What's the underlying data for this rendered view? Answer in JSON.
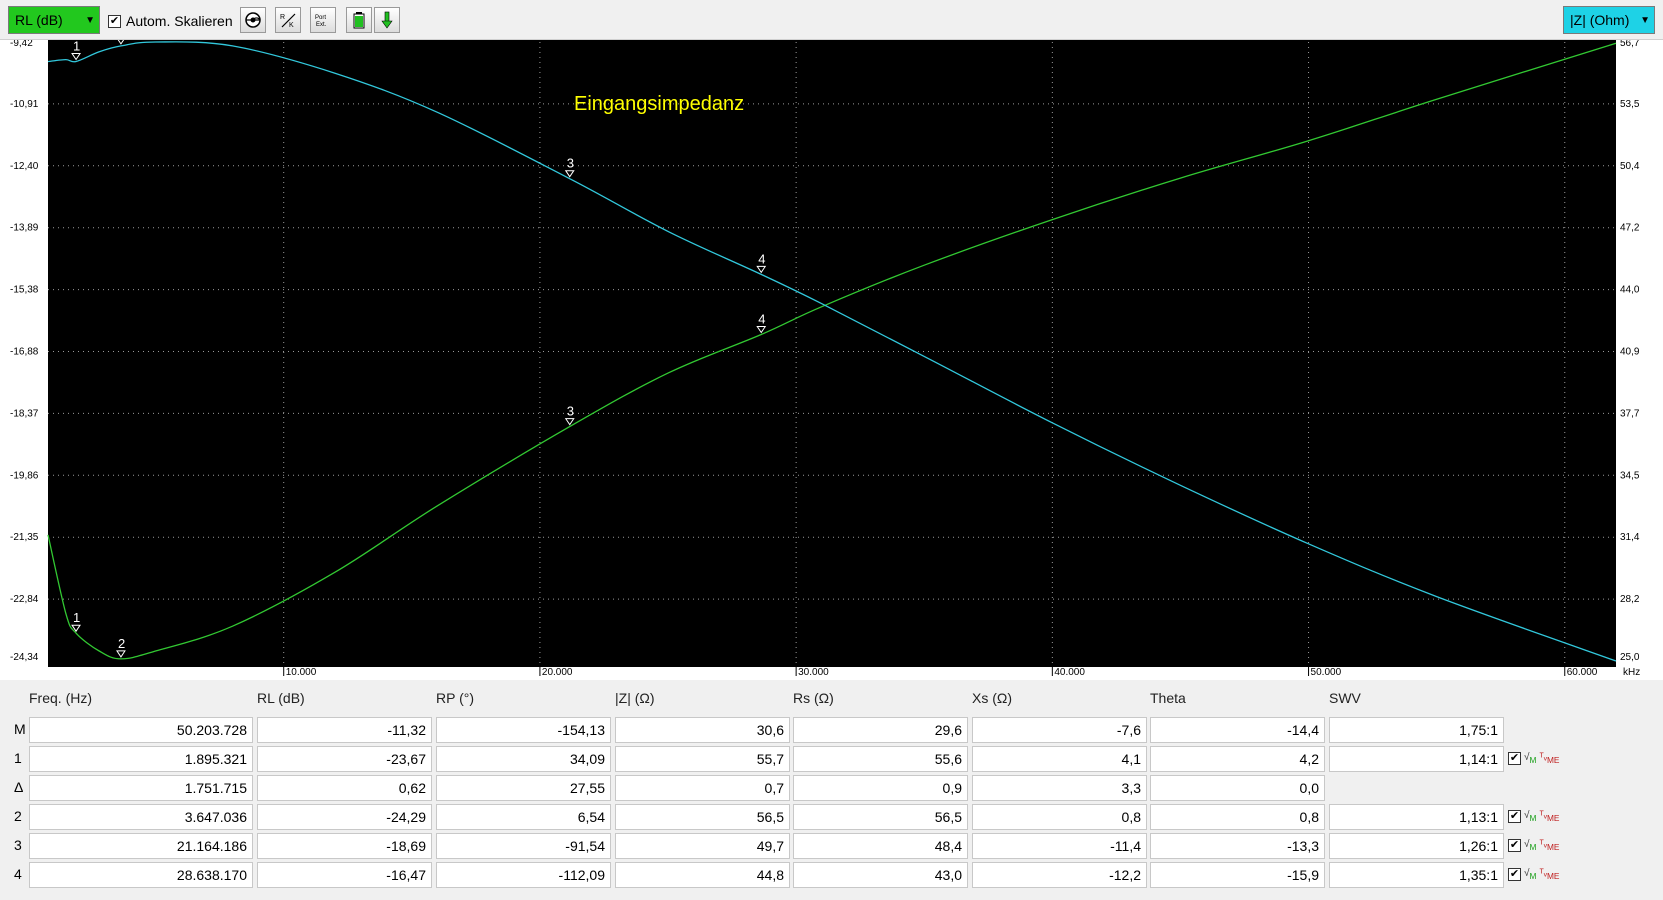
{
  "toolbar": {
    "left_display": "RL (dB)",
    "autoscale_label": "Autom. Skalieren",
    "autoscale_checked": true,
    "right_display": "|Z| (Ohm)",
    "buttons": [
      "smith-chart-icon",
      "scale-icon",
      "port-ext-icon",
      "battery-icon",
      "download-icon"
    ]
  },
  "chart": {
    "title": "Eingangsimpedanz",
    "x_unit": "kHz",
    "left_ticks": [
      "-9,42",
      "-10,91",
      "-12,40",
      "-13,89",
      "-15,38",
      "-16,88",
      "-18,37",
      "-19,86",
      "-21,35",
      "-22,84",
      "-24,34"
    ],
    "right_ticks": [
      "56,7",
      "53,5",
      "50,4",
      "47,2",
      "44,0",
      "40,9",
      "37,7",
      "34,5",
      "31,4",
      "28,2",
      "25,0"
    ],
    "x_ticks": [
      "10.000",
      "20.000",
      "30.000",
      "40.000",
      "50.000",
      "60.000"
    ],
    "colors": {
      "rl": "#32c832",
      "z": "#32c8dc",
      "title": "#ffff00",
      "background": "#000000"
    }
  },
  "chart_data": {
    "type": "line",
    "title": "Eingangsimpedanz",
    "xlabel": "kHz",
    "x_range_khz": [
      800,
      62000
    ],
    "y_left": {
      "label": "RL (dB)",
      "range": [
        -24.34,
        -9.42
      ]
    },
    "y_right": {
      "label": "|Z| (Ohm)",
      "range": [
        25.0,
        56.7
      ]
    },
    "series": [
      {
        "name": "RL (dB)",
        "axis": "left",
        "x": [
          800,
          1500,
          1895,
          2800,
          3647,
          5000,
          8000,
          12000,
          16000,
          21164,
          25000,
          28638,
          31000,
          35000,
          40000,
          45000,
          50000,
          55000,
          62000
        ],
        "y": [
          -21.3,
          -23.2,
          -23.67,
          -24.1,
          -24.29,
          -24.1,
          -23.5,
          -22.2,
          -20.6,
          -18.69,
          -17.4,
          -16.47,
          -15.8,
          -14.8,
          -13.7,
          -12.7,
          -11.8,
          -10.8,
          -9.45
        ]
      },
      {
        "name": "|Z| (Ohm)",
        "axis": "right",
        "x": [
          800,
          1500,
          1895,
          2800,
          3647,
          5000,
          8000,
          12000,
          16000,
          21164,
          25000,
          28638,
          31000,
          35000,
          40000,
          45000,
          50000,
          55000,
          62000
        ],
        "y": [
          55.7,
          55.8,
          55.7,
          56.2,
          56.5,
          56.7,
          56.5,
          55.1,
          53.1,
          49.7,
          47.0,
          44.8,
          43.3,
          40.6,
          37.2,
          34.0,
          31.0,
          28.3,
          25.0
        ]
      }
    ],
    "markers": [
      {
        "label": "1",
        "x": 1895,
        "rl": -23.67,
        "z": 55.7
      },
      {
        "label": "2",
        "x": 3647,
        "rl": -24.29,
        "z": 56.5
      },
      {
        "label": "3",
        "x": 21164,
        "rl": -18.69,
        "z": 49.7
      },
      {
        "label": "4",
        "x": 28638,
        "rl": -16.47,
        "z": 44.8
      }
    ]
  },
  "table": {
    "headers": [
      "Freq. (Hz)",
      "RL (dB)",
      "RP (°)",
      "|Z| (Ω)",
      "Rs (Ω)",
      "Xs (Ω)",
      "Theta",
      "SWV"
    ],
    "rows": [
      {
        "label": "M",
        "values": [
          "50.203.728",
          "-11,32",
          "-154,13",
          "30,6",
          "29,6",
          "-7,6",
          "-14,4",
          "1,75:1"
        ],
        "icons": false
      },
      {
        "label": "1",
        "values": [
          "1.895.321",
          "-23,67",
          "34,09",
          "55,7",
          "55,6",
          "4,1",
          "4,2",
          "1,14:1"
        ],
        "icons": true
      },
      {
        "label": "Δ",
        "values": [
          "1.751.715",
          "0,62",
          "27,55",
          "0,7",
          "0,9",
          "3,3",
          "0,0",
          ""
        ],
        "icons": false
      },
      {
        "label": "2",
        "values": [
          "3.647.036",
          "-24,29",
          "6,54",
          "56,5",
          "56,5",
          "0,8",
          "0,8",
          "1,13:1"
        ],
        "icons": true
      },
      {
        "label": "3",
        "values": [
          "21.164.186",
          "-18,69",
          "-91,54",
          "49,7",
          "48,4",
          "-11,4",
          "-13,3",
          "1,26:1"
        ],
        "icons": true
      },
      {
        "label": "4",
        "values": [
          "28.638.170",
          "-16,47",
          "-112,09",
          "44,8",
          "43,0",
          "-12,2",
          "-15,9",
          "1,35:1"
        ],
        "icons": true
      }
    ]
  }
}
